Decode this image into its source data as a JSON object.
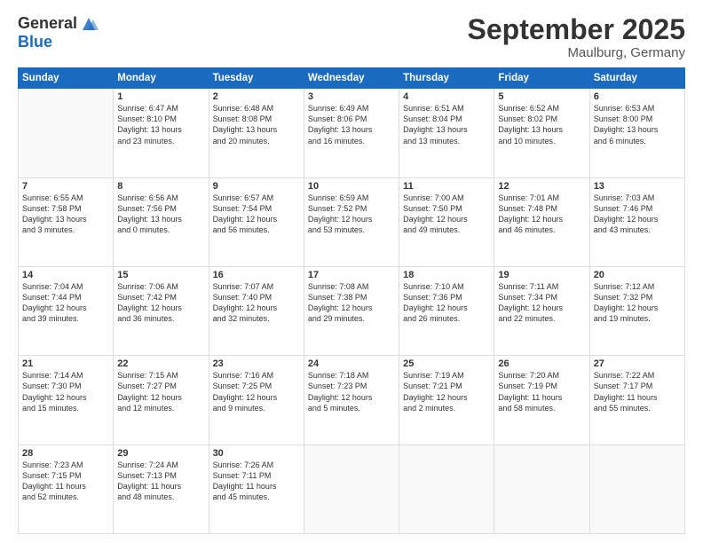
{
  "header": {
    "logo_general": "General",
    "logo_blue": "Blue",
    "month_title": "September 2025",
    "location": "Maulburg, Germany"
  },
  "days_of_week": [
    "Sunday",
    "Monday",
    "Tuesday",
    "Wednesday",
    "Thursday",
    "Friday",
    "Saturday"
  ],
  "weeks": [
    [
      {
        "day": "",
        "info": ""
      },
      {
        "day": "1",
        "info": "Sunrise: 6:47 AM\nSunset: 8:10 PM\nDaylight: 13 hours\nand 23 minutes."
      },
      {
        "day": "2",
        "info": "Sunrise: 6:48 AM\nSunset: 8:08 PM\nDaylight: 13 hours\nand 20 minutes."
      },
      {
        "day": "3",
        "info": "Sunrise: 6:49 AM\nSunset: 8:06 PM\nDaylight: 13 hours\nand 16 minutes."
      },
      {
        "day": "4",
        "info": "Sunrise: 6:51 AM\nSunset: 8:04 PM\nDaylight: 13 hours\nand 13 minutes."
      },
      {
        "day": "5",
        "info": "Sunrise: 6:52 AM\nSunset: 8:02 PM\nDaylight: 13 hours\nand 10 minutes."
      },
      {
        "day": "6",
        "info": "Sunrise: 6:53 AM\nSunset: 8:00 PM\nDaylight: 13 hours\nand 6 minutes."
      }
    ],
    [
      {
        "day": "7",
        "info": "Sunrise: 6:55 AM\nSunset: 7:58 PM\nDaylight: 13 hours\nand 3 minutes."
      },
      {
        "day": "8",
        "info": "Sunrise: 6:56 AM\nSunset: 7:56 PM\nDaylight: 13 hours\nand 0 minutes."
      },
      {
        "day": "9",
        "info": "Sunrise: 6:57 AM\nSunset: 7:54 PM\nDaylight: 12 hours\nand 56 minutes."
      },
      {
        "day": "10",
        "info": "Sunrise: 6:59 AM\nSunset: 7:52 PM\nDaylight: 12 hours\nand 53 minutes."
      },
      {
        "day": "11",
        "info": "Sunrise: 7:00 AM\nSunset: 7:50 PM\nDaylight: 12 hours\nand 49 minutes."
      },
      {
        "day": "12",
        "info": "Sunrise: 7:01 AM\nSunset: 7:48 PM\nDaylight: 12 hours\nand 46 minutes."
      },
      {
        "day": "13",
        "info": "Sunrise: 7:03 AM\nSunset: 7:46 PM\nDaylight: 12 hours\nand 43 minutes."
      }
    ],
    [
      {
        "day": "14",
        "info": "Sunrise: 7:04 AM\nSunset: 7:44 PM\nDaylight: 12 hours\nand 39 minutes."
      },
      {
        "day": "15",
        "info": "Sunrise: 7:06 AM\nSunset: 7:42 PM\nDaylight: 12 hours\nand 36 minutes."
      },
      {
        "day": "16",
        "info": "Sunrise: 7:07 AM\nSunset: 7:40 PM\nDaylight: 12 hours\nand 32 minutes."
      },
      {
        "day": "17",
        "info": "Sunrise: 7:08 AM\nSunset: 7:38 PM\nDaylight: 12 hours\nand 29 minutes."
      },
      {
        "day": "18",
        "info": "Sunrise: 7:10 AM\nSunset: 7:36 PM\nDaylight: 12 hours\nand 26 minutes."
      },
      {
        "day": "19",
        "info": "Sunrise: 7:11 AM\nSunset: 7:34 PM\nDaylight: 12 hours\nand 22 minutes."
      },
      {
        "day": "20",
        "info": "Sunrise: 7:12 AM\nSunset: 7:32 PM\nDaylight: 12 hours\nand 19 minutes."
      }
    ],
    [
      {
        "day": "21",
        "info": "Sunrise: 7:14 AM\nSunset: 7:30 PM\nDaylight: 12 hours\nand 15 minutes."
      },
      {
        "day": "22",
        "info": "Sunrise: 7:15 AM\nSunset: 7:27 PM\nDaylight: 12 hours\nand 12 minutes."
      },
      {
        "day": "23",
        "info": "Sunrise: 7:16 AM\nSunset: 7:25 PM\nDaylight: 12 hours\nand 9 minutes."
      },
      {
        "day": "24",
        "info": "Sunrise: 7:18 AM\nSunset: 7:23 PM\nDaylight: 12 hours\nand 5 minutes."
      },
      {
        "day": "25",
        "info": "Sunrise: 7:19 AM\nSunset: 7:21 PM\nDaylight: 12 hours\nand 2 minutes."
      },
      {
        "day": "26",
        "info": "Sunrise: 7:20 AM\nSunset: 7:19 PM\nDaylight: 11 hours\nand 58 minutes."
      },
      {
        "day": "27",
        "info": "Sunrise: 7:22 AM\nSunset: 7:17 PM\nDaylight: 11 hours\nand 55 minutes."
      }
    ],
    [
      {
        "day": "28",
        "info": "Sunrise: 7:23 AM\nSunset: 7:15 PM\nDaylight: 11 hours\nand 52 minutes."
      },
      {
        "day": "29",
        "info": "Sunrise: 7:24 AM\nSunset: 7:13 PM\nDaylight: 11 hours\nand 48 minutes."
      },
      {
        "day": "30",
        "info": "Sunrise: 7:26 AM\nSunset: 7:11 PM\nDaylight: 11 hours\nand 45 minutes."
      },
      {
        "day": "",
        "info": ""
      },
      {
        "day": "",
        "info": ""
      },
      {
        "day": "",
        "info": ""
      },
      {
        "day": "",
        "info": ""
      }
    ]
  ]
}
